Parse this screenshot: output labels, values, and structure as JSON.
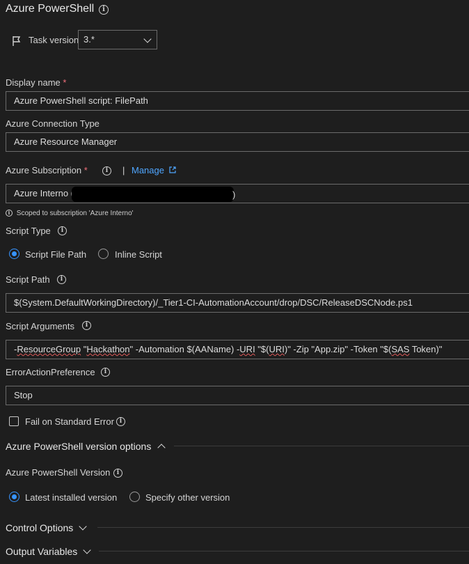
{
  "header": {
    "title": "Azure PowerShell"
  },
  "task_version": {
    "label": "Task version",
    "value": "3.*"
  },
  "display_name": {
    "label": "Display name",
    "required": "*",
    "value": "Azure PowerShell script: FilePath"
  },
  "connection_type": {
    "label": "Azure Connection Type",
    "value": "Azure Resource Manager"
  },
  "subscription": {
    "label": "Azure Subscription",
    "required": "*",
    "separator": "|",
    "manage_label": "Manage",
    "value": "Azure Interno (",
    "value_end": ")",
    "hint": "Scoped to subscription 'Azure Interno'"
  },
  "script_type": {
    "label": "Script Type",
    "options": [
      {
        "label": "Script File Path",
        "selected": true
      },
      {
        "label": "Inline Script",
        "selected": false
      }
    ]
  },
  "script_path": {
    "label": "Script Path",
    "value": "$(System.DefaultWorkingDirectory)/_Tier1-CI-AutomationAccount/drop/DSC/ReleaseDSCNode.ps1"
  },
  "script_arguments": {
    "label": "Script Arguments",
    "parts": {
      "p1": "-",
      "p2": "ResourceGroup",
      "p3": " \"",
      "p4": "Hackathon",
      "p5": "\" -Automation $(AAName) -",
      "p6": "URI",
      "p7": " \"$(",
      "p8": "URI",
      "p9": ")\" -Zip \"App.zip\" -Token \"$(",
      "p10": "SAS",
      "p11": " Token)\""
    }
  },
  "error_action": {
    "label": "ErrorActionPreference",
    "value": "Stop"
  },
  "fail_on_stderr": {
    "label": "Fail on Standard Error",
    "checked": false
  },
  "version_options": {
    "section_label": "Azure PowerShell version options",
    "version_label": "Azure PowerShell Version",
    "options": [
      {
        "label": "Latest installed version",
        "selected": true
      },
      {
        "label": "Specify other version",
        "selected": false
      }
    ]
  },
  "control_options": {
    "section_label": "Control Options"
  },
  "output_variables": {
    "section_label": "Output Variables"
  },
  "colors": {
    "background": "#1e1e1e",
    "accent": "#3794ff",
    "link": "#4fa6ff",
    "required": "#f1707b"
  },
  "icons": [
    "info-icon",
    "flag-icon",
    "chevron-down-icon",
    "chevron-up-icon",
    "external-link-icon"
  ]
}
